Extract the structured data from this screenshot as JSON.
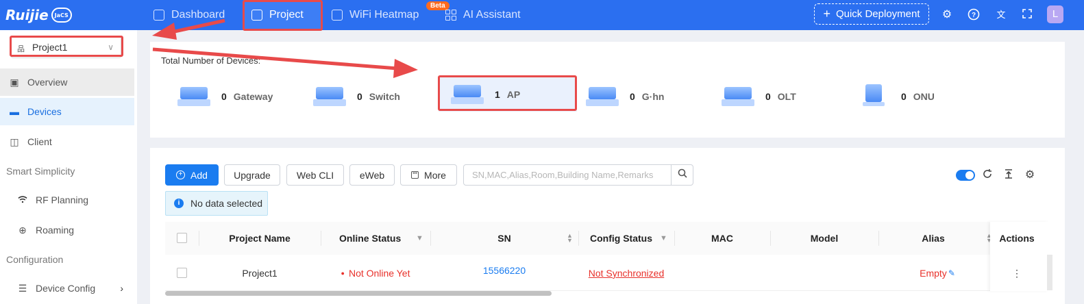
{
  "topbar": {
    "logo": "Ruijie",
    "logo_badge": "JaCS",
    "nav": [
      {
        "label": "Dashboard",
        "active": false
      },
      {
        "label": "Project",
        "active": true
      },
      {
        "label": "WiFi Heatmap",
        "active": false
      },
      {
        "label": "AI Assistant",
        "active": false
      }
    ],
    "beta_badge": "Beta",
    "quick_deployment": "Quick Deployment",
    "avatar_initial": "L",
    "icons": [
      "gear-icon",
      "help-icon",
      "translate-icon",
      "fullscreen-icon"
    ],
    "accent_color": "#2b6ff0"
  },
  "sidebar": {
    "project_select": {
      "value": "Project1"
    },
    "items": [
      {
        "label": "Overview"
      },
      {
        "label": "Devices",
        "active": true
      },
      {
        "label": "Client"
      }
    ],
    "groups": [
      {
        "title": "Smart Simplicity",
        "items": [
          {
            "label": "RF Planning"
          },
          {
            "label": "Roaming"
          }
        ]
      },
      {
        "title": "Configuration",
        "items": [
          {
            "label": "Device Config"
          }
        ]
      }
    ]
  },
  "summary": {
    "title": "Total Number of Devices:",
    "devices": [
      {
        "type": "Gateway",
        "count": "0"
      },
      {
        "type": "Switch",
        "count": "0"
      },
      {
        "type": "AP",
        "count": "1",
        "highlighted": true
      },
      {
        "type": "G·hn",
        "count": "0"
      },
      {
        "type": "OLT",
        "count": "0"
      },
      {
        "type": "ONU",
        "count": "0"
      }
    ]
  },
  "toolbar": {
    "add": "Add",
    "upgrade": "Upgrade",
    "webcli": "Web CLI",
    "eweb": "eWeb",
    "more": "More",
    "search_placeholder": "SN,MAC,Alias,Room,Building Name,Remarks",
    "auto_refresh_on": true
  },
  "selection_info": "No data selected",
  "table": {
    "columns": [
      "Project Name",
      "Online Status",
      "SN",
      "Config Status",
      "MAC",
      "Model",
      "Alias",
      "Actions"
    ],
    "rows": [
      {
        "project_name": "Project1",
        "online_status": "Not Online Yet",
        "sn": "15566220",
        "config_status": "Not Synchronized",
        "mac": "",
        "model": "",
        "alias": "Empty",
        "actions": "⋮"
      }
    ]
  },
  "annotation_color": "#e84a4a"
}
